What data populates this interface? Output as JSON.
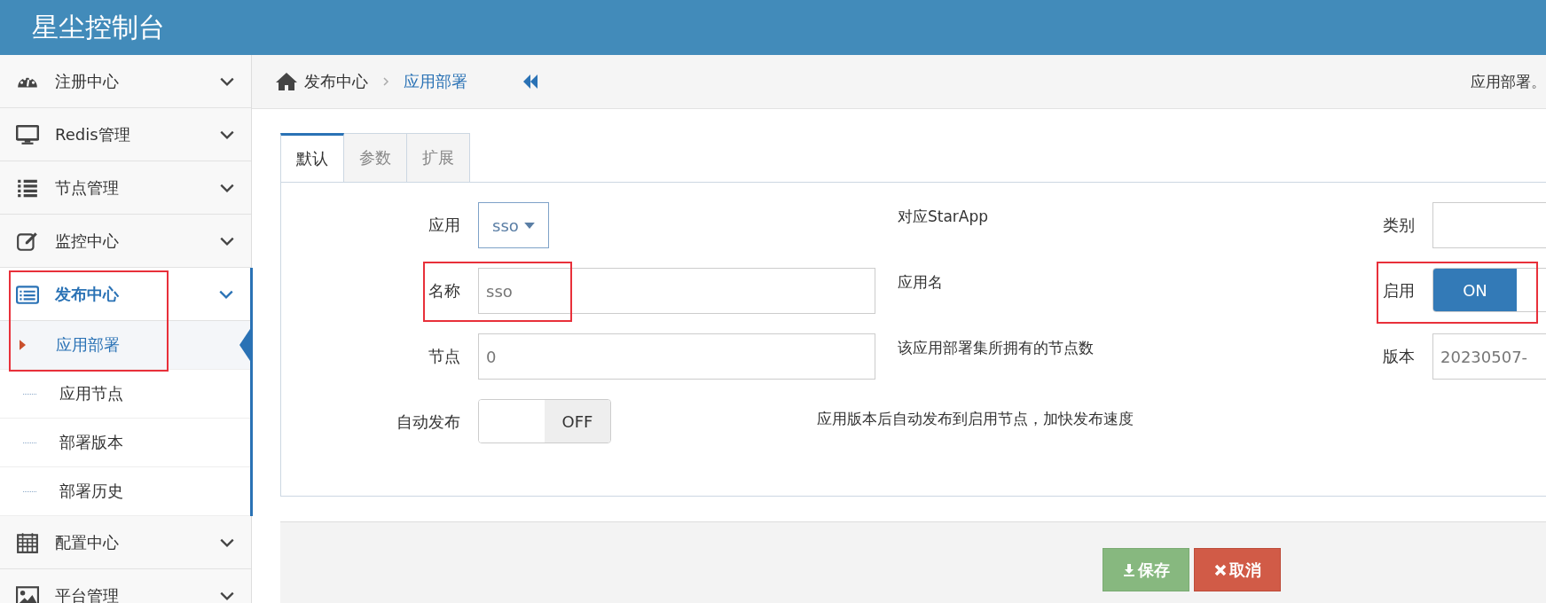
{
  "header": {
    "title": "星尘控制台"
  },
  "sidebar": {
    "items": [
      {
        "label": "注册中心",
        "expanded": false,
        "highlighted": false
      },
      {
        "label": "Redis管理",
        "expanded": false,
        "highlighted": false
      },
      {
        "label": "节点管理",
        "expanded": false,
        "highlighted": false
      },
      {
        "label": "监控中心",
        "expanded": false,
        "highlighted": false
      },
      {
        "label": "发布中心",
        "expanded": true,
        "highlighted": true,
        "children": [
          {
            "label": "应用部署",
            "selected": true
          },
          {
            "label": "应用节点",
            "selected": false
          },
          {
            "label": "部署版本",
            "selected": false
          },
          {
            "label": "部署历史",
            "selected": false
          }
        ]
      },
      {
        "label": "配置中心",
        "expanded": false,
        "highlighted": false
      },
      {
        "label": "平台管理",
        "expanded": false,
        "highlighted": false
      }
    ]
  },
  "breadcrumb": {
    "items": [
      "发布中心",
      "应用部署"
    ],
    "page_note": "应用部署。"
  },
  "tabs": [
    {
      "label": "默认",
      "selected": true
    },
    {
      "label": "参数",
      "selected": false
    },
    {
      "label": "扩展",
      "selected": false
    }
  ],
  "form": {
    "rows": [
      {
        "label": "应用",
        "kind": "select",
        "value": "sso",
        "help": "对应StarApp",
        "highlighted": false,
        "side": {
          "label": "类别",
          "kind": "text",
          "highlighted": false
        }
      },
      {
        "label": "名称",
        "kind": "text",
        "value": "sso",
        "help": "应用名",
        "highlighted": true,
        "side": {
          "label": "启用",
          "kind": "toggle",
          "on": true,
          "text": "ON",
          "highlighted": true
        }
      },
      {
        "label": "节点",
        "kind": "text",
        "value": "0",
        "help": "该应用部署集所拥有的节点数",
        "highlighted": false,
        "side": {
          "label": "版本",
          "kind": "text",
          "value": "20230507-",
          "highlighted": false
        }
      },
      {
        "label": "自动发布",
        "kind": "toggle",
        "on": false,
        "text": "OFF",
        "help": "应用版本后自动发布到启用节点，加快发布速度",
        "highlighted": false
      }
    ]
  },
  "buttons": [
    {
      "label": "保存",
      "kind": "save"
    },
    {
      "label": "取消",
      "kind": "cancel"
    }
  ]
}
